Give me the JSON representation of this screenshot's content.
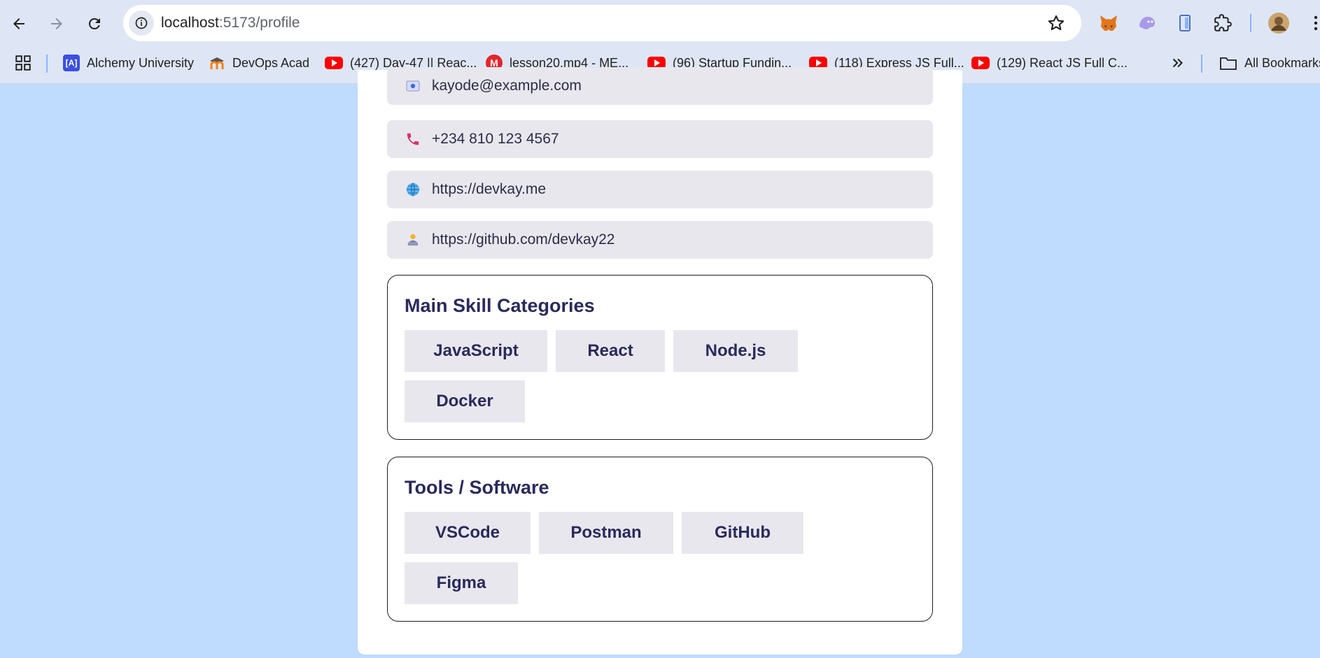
{
  "browser": {
    "url_host": "localhost",
    "url_path": ":5173/profile",
    "bookmarks": [
      {
        "label": "Alchemy University",
        "favicon": "alchemy-icon"
      },
      {
        "label": "DevOps Acad",
        "favicon": "moodle-icon"
      },
      {
        "label": "(427) Day-47 || Reac...",
        "favicon": "youtube-icon"
      },
      {
        "label": "lesson20.mp4 - ME...",
        "favicon": "mega-icon"
      },
      {
        "label": "(96) Startup Fundin...",
        "favicon": "youtube-icon"
      },
      {
        "label": "(118) Express JS Full...",
        "favicon": "youtube-icon"
      },
      {
        "label": "(129) React JS Full C...",
        "favicon": "youtube-icon"
      }
    ],
    "all_bookmarks_label": "All Bookmarks"
  },
  "profile": {
    "contacts": [
      {
        "icon": "email-icon",
        "value": "kayode@example.com"
      },
      {
        "icon": "phone-icon",
        "value": "+234 810 123 4567"
      },
      {
        "icon": "globe-icon",
        "value": "https://devkay.me"
      },
      {
        "icon": "developer-icon",
        "value": "https://github.com/devkay22"
      }
    ],
    "skills": {
      "title": "Main Skill Categories",
      "items": [
        "JavaScript",
        "React",
        "Node.js",
        "Docker"
      ]
    },
    "tools": {
      "title": "Tools / Software",
      "items": [
        "VSCode",
        "Postman",
        "GitHub",
        "Figma"
      ]
    }
  },
  "colors": {
    "page_background": "#bfdbfe",
    "card_background": "#ffffff",
    "chip_background": "#e8e7ee",
    "heading_text": "#2a2a5a"
  }
}
